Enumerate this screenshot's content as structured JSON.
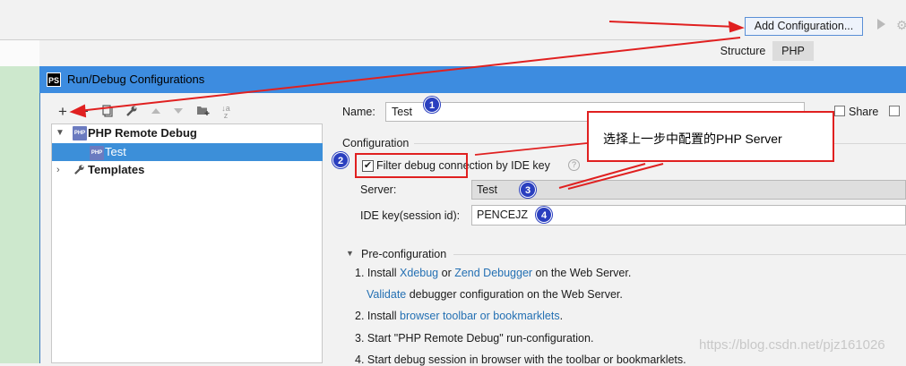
{
  "ide": {
    "add_config_label": "Add Configuration...",
    "tabs": [
      "Structure",
      "PHP"
    ]
  },
  "dialog": {
    "logo": "PS",
    "title": "Run/Debug Configurations"
  },
  "toolbar_icons": [
    "add-icon",
    "remove-icon",
    "copy-icon",
    "wrench-icon",
    "move-up-icon",
    "move-down-icon",
    "new-folder-icon",
    "sort-icon"
  ],
  "tree": {
    "group_label": "PHP Remote Debug",
    "group_icon_text": "PHP",
    "item_label": "Test",
    "templates_label": "Templates"
  },
  "form": {
    "name_label": "Name:",
    "name_value": "Test",
    "share_label": "Share",
    "configuration_label": "Configuration",
    "filter_label": "Filter debug connection by IDE key",
    "filter_checked": true,
    "server_label": "Server:",
    "server_value": "Test",
    "idekey_label": "IDE key(session id):",
    "idekey_value": "PENCEJZ",
    "preconfig_label": "Pre-configuration"
  },
  "steps": {
    "s1_a": "1. Install ",
    "s1_link1": "Xdebug",
    "s1_b": " or ",
    "s1_link2": "Zend Debugger",
    "s1_c": " on the Web Server.",
    "s1b_link": "Validate",
    "s1b_text": " debugger configuration on the Web Server.",
    "s2_a": "2. Install ",
    "s2_link": "browser toolbar or bookmarklets",
    "s2_b": ".",
    "s3": "3. Start \"PHP Remote Debug\" run-configuration.",
    "s4": "4. Start debug session in browser with the toolbar or bookmarklets."
  },
  "annotations": {
    "callout_text": "选择上一步中配置的PHP Server",
    "badges": [
      "1",
      "2",
      "3",
      "4"
    ],
    "color_red": "#e02020",
    "color_badge": "#2a3fbf"
  },
  "watermark": "https://blog.csdn.net/pjz161026"
}
